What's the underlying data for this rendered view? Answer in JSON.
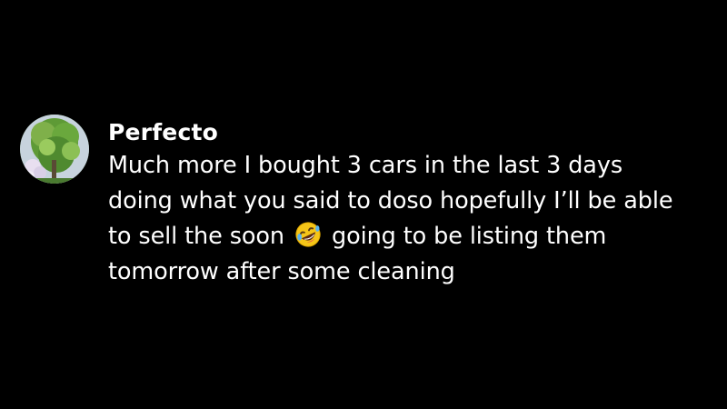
{
  "comment": {
    "avatar": {
      "icon": "avatar-tree-photo",
      "colors": {
        "sky": "#c7d3dd",
        "foliage": "#5e9a36",
        "foliage_light": "#9acb5e",
        "flowers": "#e8dff0"
      }
    },
    "author": "Perfecto",
    "text_before_emoji": "Much more I bought 3 cars in the last 3 days doing what you said to doso hopefully I’ll be able to sell the soon",
    "emoji": {
      "icon": "rolling-on-floor-laughing-emoji",
      "color": "#f5c518"
    },
    "text_after_emoji": "going to be listing them tomorrow after some cleaning"
  },
  "theme": {
    "background": "#000000",
    "text": "#ffffff"
  }
}
